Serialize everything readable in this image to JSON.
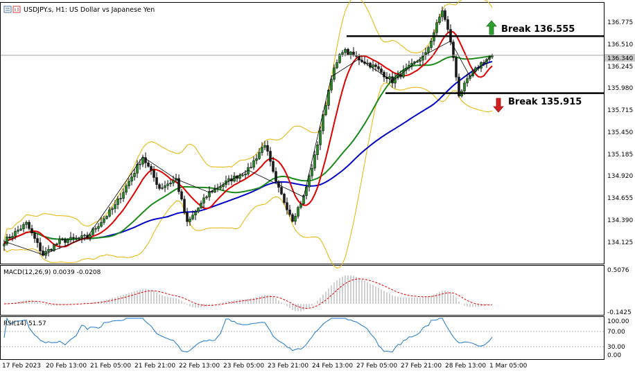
{
  "header": {
    "symbol_title": "USDJPY.s, H1:  US Dollar vs Japanese Yen"
  },
  "colors": {
    "bull_candle": "#1e8c1e",
    "bear_candle": "#1a1a1a",
    "sma_red": "#e00000",
    "sma_green": "#1a8a1a",
    "sma_blue": "#0000c8",
    "bollinger": "#e6b400",
    "zigzag": "#000000",
    "macd_hist": "#a0a0a0",
    "macd_signal": "#e00000",
    "rsi_line": "#1e78c8",
    "arrow_up": "#2e9e2e",
    "arrow_down": "#d02020"
  },
  "annotations": {
    "break_up": "Break 136.555",
    "break_down": "Break 135.915"
  },
  "price_axis": {
    "labels": [
      "136.775",
      "136.510",
      "136.245",
      "135.980",
      "135.715",
      "135.450",
      "135.185",
      "134.920",
      "134.655",
      "134.390",
      "134.125"
    ],
    "current_price": "136.340"
  },
  "macd": {
    "label": "MACD(12,26,9) 0.0039 -0.0208",
    "axis_labels": [
      "0.5076",
      "-0.1425"
    ]
  },
  "rsi": {
    "label": "RSI(14) 51.57",
    "axis_labels": [
      "100.00",
      "70.00",
      "30.00",
      "0.00"
    ]
  },
  "time_axis": {
    "labels": [
      "17 Feb 2023",
      "20 Feb 13:00",
      "21 Feb 05:00",
      "21 Feb 21:00",
      "22 Feb 13:00",
      "23 Feb 05:00",
      "23 Feb 21:00",
      "24 Feb 13:00",
      "27 Feb 05:00",
      "27 Feb 21:00",
      "28 Feb 13:00",
      "1 Mar 05:00"
    ]
  },
  "chart_data": {
    "type": "candlestick",
    "title": "USDJPY.s, H1:  US Dollar vs Japanese Yen",
    "ylim": [
      134.0,
      136.93
    ],
    "levels": [
      136.555,
      135.915
    ],
    "close_path": [
      [
        0,
        134.25
      ],
      [
        8,
        134.45
      ],
      [
        14,
        134.1
      ],
      [
        20,
        134.25
      ],
      [
        30,
        134.3
      ],
      [
        40,
        134.65
      ],
      [
        50,
        135.2
      ],
      [
        56,
        134.85
      ],
      [
        62,
        134.95
      ],
      [
        66,
        134.45
      ],
      [
        74,
        134.8
      ],
      [
        82,
        134.95
      ],
      [
        88,
        135.05
      ],
      [
        94,
        135.35
      ],
      [
        98,
        134.9
      ],
      [
        104,
        134.5
      ],
      [
        108,
        134.75
      ],
      [
        112,
        135.2
      ],
      [
        118,
        136.1
      ],
      [
        122,
        136.4
      ],
      [
        128,
        136.3
      ],
      [
        134,
        136.2
      ],
      [
        140,
        136.05
      ],
      [
        146,
        136.2
      ],
      [
        152,
        136.35
      ],
      [
        158,
        136.85
      ],
      [
        161,
        136.5
      ],
      [
        164,
        135.9
      ],
      [
        168,
        136.1
      ],
      [
        172,
        136.25
      ],
      [
        176,
        136.34
      ]
    ]
  }
}
